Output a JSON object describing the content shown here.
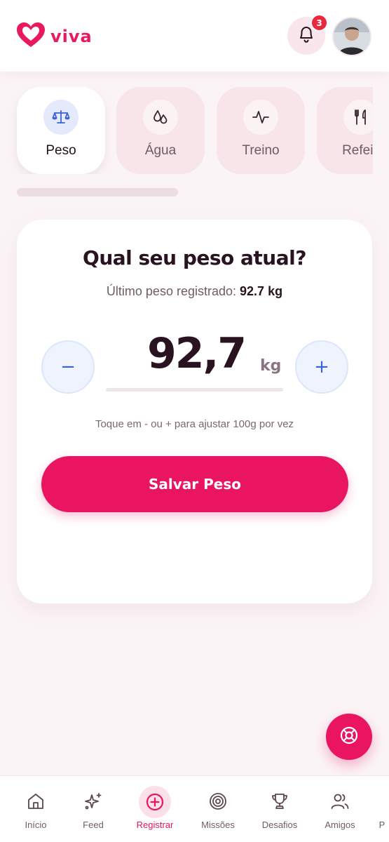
{
  "header": {
    "logo_text": "viva",
    "logo_icon": "heart-icon",
    "notifications_icon": "bell-icon",
    "notification_count": "3",
    "avatar_icon": "user-avatar"
  },
  "tabs": [
    {
      "label": "Peso",
      "icon": "scale-icon",
      "active": true
    },
    {
      "label": "Água",
      "icon": "water-drops-icon",
      "active": false
    },
    {
      "label": "Treino",
      "icon": "activity-icon",
      "active": false
    },
    {
      "label": "Refeiç",
      "icon": "utensils-icon",
      "active": false
    }
  ],
  "card": {
    "title": "Qual seu peso atual?",
    "last_weight_label": "Último peso registrado:",
    "last_weight_value": "92.7 kg",
    "weight_value": "92,7",
    "weight_unit": "kg",
    "minus_symbol": "−",
    "plus_symbol": "+",
    "hint": "Toque em - ou + para ajustar 100g por vez",
    "save_label": "Salvar Peso"
  },
  "fab": {
    "icon": "lifebuoy-icon"
  },
  "nav": [
    {
      "label": "Início",
      "icon": "home-icon",
      "active": false
    },
    {
      "label": "Feed",
      "icon": "sparkles-icon",
      "active": false
    },
    {
      "label": "Registrar",
      "icon": "plus-circle-icon",
      "active": true
    },
    {
      "label": "Missões",
      "icon": "target-icon",
      "active": false
    },
    {
      "label": "Desafios",
      "icon": "trophy-icon",
      "active": false
    },
    {
      "label": "Amigos",
      "icon": "users-icon",
      "active": false
    },
    {
      "label": "P",
      "icon": "profile-icon",
      "active": false
    }
  ],
  "colors": {
    "brand": "#e91560",
    "background": "#fbf4f6",
    "accent_blue": "#3a62d6",
    "badge_red": "#e8283f"
  }
}
